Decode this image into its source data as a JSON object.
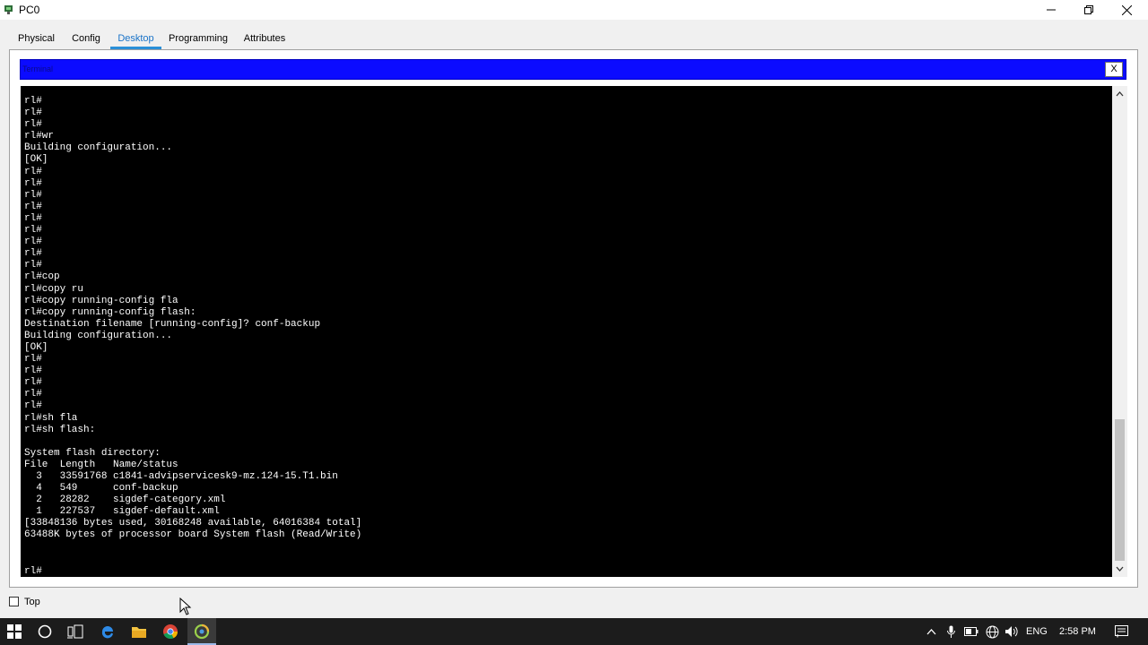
{
  "window": {
    "title": "PC0"
  },
  "tabs": [
    {
      "label": "Physical",
      "active": false
    },
    {
      "label": "Config",
      "active": false
    },
    {
      "label": "Desktop",
      "active": true
    },
    {
      "label": "Programming",
      "active": false
    },
    {
      "label": "Attributes",
      "active": false
    }
  ],
  "terminal": {
    "title": "Terminal",
    "close_label": "X",
    "lines": "rl#\nrl#\nrl#\nrl#wr\nBuilding configuration...\n[OK]\nrl#\nrl#\nrl#\nrl#\nrl#\nrl#\nrl#\nrl#\nrl#\nrl#cop\nrl#copy ru\nrl#copy running-config fla\nrl#copy running-config flash:\nDestination filename [running-config]? conf-backup\nBuilding configuration...\n[OK]\nrl#\nrl#\nrl#\nrl#\nrl#\nrl#sh fla\nrl#sh flash:\n\nSystem flash directory:\nFile  Length   Name/status\n  3   33591768 c1841-advipservicesk9-mz.124-15.T1.bin\n  4   549      conf-backup\n  2   28282    sigdef-category.xml\n  1   227537   sigdef-default.xml\n[33848136 bytes used, 30168248 available, 64016384 total]\n63488K bytes of processor board System flash (Read/Write)",
    "prompt": "rl#"
  },
  "footer": {
    "top_label": "Top",
    "top_checked": false
  },
  "taskbar": {
    "language": "ENG",
    "time": "2:58 PM",
    "icons": [
      "windows-start-icon",
      "cortana-icon",
      "task-view-icon",
      "edge-icon",
      "file-explorer-icon",
      "chrome-icon",
      "packet-tracer-icon"
    ]
  },
  "colors": {
    "terminal_header": "#0b0bff",
    "terminal_bg": "#000000",
    "active_tab": "#1a73c8"
  }
}
